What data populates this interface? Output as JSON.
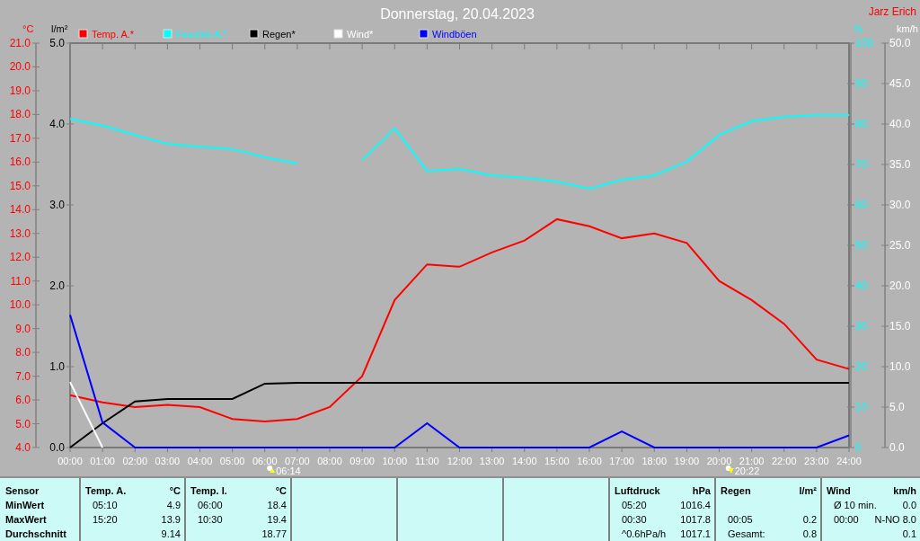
{
  "title": "Donnerstag, 20.04.2023",
  "author": "Jarz Erich",
  "chart": {
    "temperature_rain": {
      "chart_data": {
        "type": "line",
        "categories": [
          "00:00",
          "01:00",
          "02:00",
          "03:00",
          "04:00",
          "05:00",
          "06:00",
          "07:00",
          "08:00",
          "09:00",
          "10:00",
          "11:00",
          "12:00",
          "13:00",
          "14:00",
          "15:00",
          "16:00",
          "17:00",
          "18:00",
          "19:00",
          "20:00",
          "21:00",
          "22:00",
          "23:00",
          "24:00"
        ],
        "ylabel": "°C",
        "ylim": [
          4,
          21
        ],
        "yticks": [
          {
            "value": 4,
            "label": "4.0"
          },
          {
            "value": 5,
            "label": "5.0"
          },
          {
            "value": 6,
            "label": "6.0"
          },
          {
            "value": 7,
            "label": "7.0"
          },
          {
            "value": 8,
            "label": "8.0"
          },
          {
            "value": 9,
            "label": "9.0"
          },
          {
            "value": 10,
            "label": "10.0"
          },
          {
            "value": 11,
            "label": "11.0"
          },
          {
            "value": 12,
            "label": "12.0"
          },
          {
            "value": 13,
            "label": "13.0"
          },
          {
            "value": 14,
            "label": "14.0"
          },
          {
            "value": 15,
            "label": "15.0"
          },
          {
            "value": 16,
            "label": "16.0"
          },
          {
            "value": 17,
            "label": "17.0"
          },
          {
            "value": 18,
            "label": "18.0"
          },
          {
            "value": 19,
            "label": "19.0"
          },
          {
            "value": 20,
            "label": "20.0"
          },
          {
            "value": 21,
            "label": "21.0"
          }
        ],
        "y2label": "l/m²",
        "y2lim": [
          0,
          5
        ],
        "y2ticks": [
          {
            "value": 0,
            "label": "0.0"
          },
          {
            "value": 1,
            "label": "1.0"
          },
          {
            "value": 2,
            "label": "2.0"
          },
          {
            "value": 3,
            "label": "3.0"
          },
          {
            "value": 4,
            "label": "4.0"
          },
          {
            "value": 5,
            "label": "5.0"
          }
        ],
        "series": [
          {
            "name": "Temp. A.*",
            "color": "#ff0000",
            "values": [
              6.2,
              5.9,
              5.7,
              5.8,
              5.7,
              5.2,
              5.1,
              5.2,
              5.7,
              7.0,
              10.2,
              11.7,
              11.6,
              12.2,
              12.7,
              13.6,
              13.3,
              12.8,
              13.0,
              12.6,
              11.0,
              10.2,
              9.2,
              7.7,
              7.3
            ]
          },
          {
            "name": "Regen*",
            "color": "#000000",
            "axis": "y2",
            "values": [
              0.0,
              0.3,
              0.57,
              0.6,
              0.6,
              0.6,
              0.79,
              0.8,
              0.8,
              0.8,
              0.8,
              0.8,
              0.8,
              0.8,
              0.8,
              0.8,
              0.8,
              0.8,
              0.8,
              0.8,
              0.8,
              0.8,
              0.8,
              0.8,
              0.8
            ]
          }
        ]
      }
    },
    "humidity_wind": {
      "chart_data": {
        "type": "line",
        "ylabel": "%",
        "ylim": [
          0,
          100
        ],
        "yticks": [
          {
            "value": 0,
            "label": "0"
          },
          {
            "value": 10,
            "label": "10"
          },
          {
            "value": 20,
            "label": "20"
          },
          {
            "value": 30,
            "label": "30"
          },
          {
            "value": 40,
            "label": "40"
          },
          {
            "value": 50,
            "label": "50"
          },
          {
            "value": 60,
            "label": "60"
          },
          {
            "value": 70,
            "label": "70"
          },
          {
            "value": 80,
            "label": "80"
          },
          {
            "value": 90,
            "label": "90"
          },
          {
            "value": 100,
            "label": "100"
          }
        ],
        "y2label": "km/h",
        "y2lim": [
          0,
          50
        ],
        "y2ticks": [
          {
            "value": 0,
            "label": "0.0"
          },
          {
            "value": 5,
            "label": "5.0"
          },
          {
            "value": 10,
            "label": "10.0"
          },
          {
            "value": 15,
            "label": "15.0"
          },
          {
            "value": 20,
            "label": "20.0"
          },
          {
            "value": 25,
            "label": "25.0"
          },
          {
            "value": 30,
            "label": "30.0"
          },
          {
            "value": 35,
            "label": "35.0"
          },
          {
            "value": 40,
            "label": "40.0"
          },
          {
            "value": 45,
            "label": "45.0"
          },
          {
            "value": 50,
            "label": "50.0"
          }
        ],
        "series": [
          {
            "name": "Feuchte A.*",
            "color": "#00ffff",
            "values": [
              81.3,
              79.6,
              77.3,
              75.1,
              74.4,
              73.8,
              71.8,
              70.2,
              null,
              71.1,
              78.9,
              68.4,
              68.9,
              67.3,
              66.7,
              65.8,
              64.0,
              66.2,
              67.3,
              70.7,
              77.3,
              80.7,
              81.8,
              82.2,
              82.2
            ]
          },
          {
            "name": "Wind*",
            "color": "#ffffff",
            "axis": "y2",
            "values": [
              8.1,
              0,
              null,
              null,
              null,
              null,
              null,
              null,
              null,
              null,
              null,
              null,
              null,
              null,
              null,
              null,
              null,
              null,
              null,
              null,
              null,
              null,
              null,
              null,
              null
            ]
          },
          {
            "name": "Windböen",
            "color": "#0000ff",
            "axis": "y2",
            "values": [
              16.4,
              3.1,
              0,
              0,
              0,
              0,
              0,
              0,
              0,
              0,
              0,
              3.0,
              0,
              0,
              0,
              0,
              0,
              2.0,
              0,
              0,
              0,
              0,
              0,
              0,
              1.5
            ]
          }
        ]
      }
    },
    "sun_events": [
      {
        "kind": "sunrise",
        "time": "06:14"
      },
      {
        "kind": "sunset",
        "time": "20:22"
      }
    ]
  },
  "stats": {
    "row_labels": [
      "Sensor",
      "MinWert",
      "MaxWert",
      "Durchschnitt"
    ],
    "panels": [
      {
        "kind": "sensor",
        "title": "Temp. A.",
        "unit": "°C",
        "rows": [
          {
            "time": "05:10",
            "value": "4.9"
          },
          {
            "time": "15:20",
            "value": "13.9"
          },
          {
            "value": "9.14"
          }
        ]
      },
      {
        "kind": "sensor",
        "title": "Temp. I.",
        "unit": "°C",
        "rows": [
          {
            "time": "06:00",
            "value": "18.4"
          },
          {
            "time": "10:30",
            "value": "19.4"
          },
          {
            "value": "18.77"
          }
        ]
      },
      {
        "kind": "empty"
      },
      {
        "kind": "empty"
      },
      {
        "kind": "empty"
      },
      {
        "kind": "sensor",
        "title": "Luftdruck",
        "unit": "hPa",
        "rows": [
          {
            "time": "05:20",
            "value": "1016.4"
          },
          {
            "time": "00:30",
            "value": "1017.8"
          },
          {
            "time": "^0.6hPa/h",
            "value": "1017.1"
          }
        ]
      },
      {
        "kind": "sensor",
        "title": "Regen",
        "unit": "l/m²",
        "rows": [
          {},
          {
            "time": "00:05",
            "value": "0.2"
          },
          {
            "time": "Gesamt:",
            "value": "0.8"
          }
        ]
      },
      {
        "kind": "sensor",
        "title": "Wind",
        "unit": "km/h",
        "rows": [
          {
            "time": "Ø 10 min.",
            "value": "0.0"
          },
          {
            "time": "00:00",
            "value": "N-NO 8.0"
          },
          {
            "value": "0.1"
          }
        ]
      }
    ]
  }
}
